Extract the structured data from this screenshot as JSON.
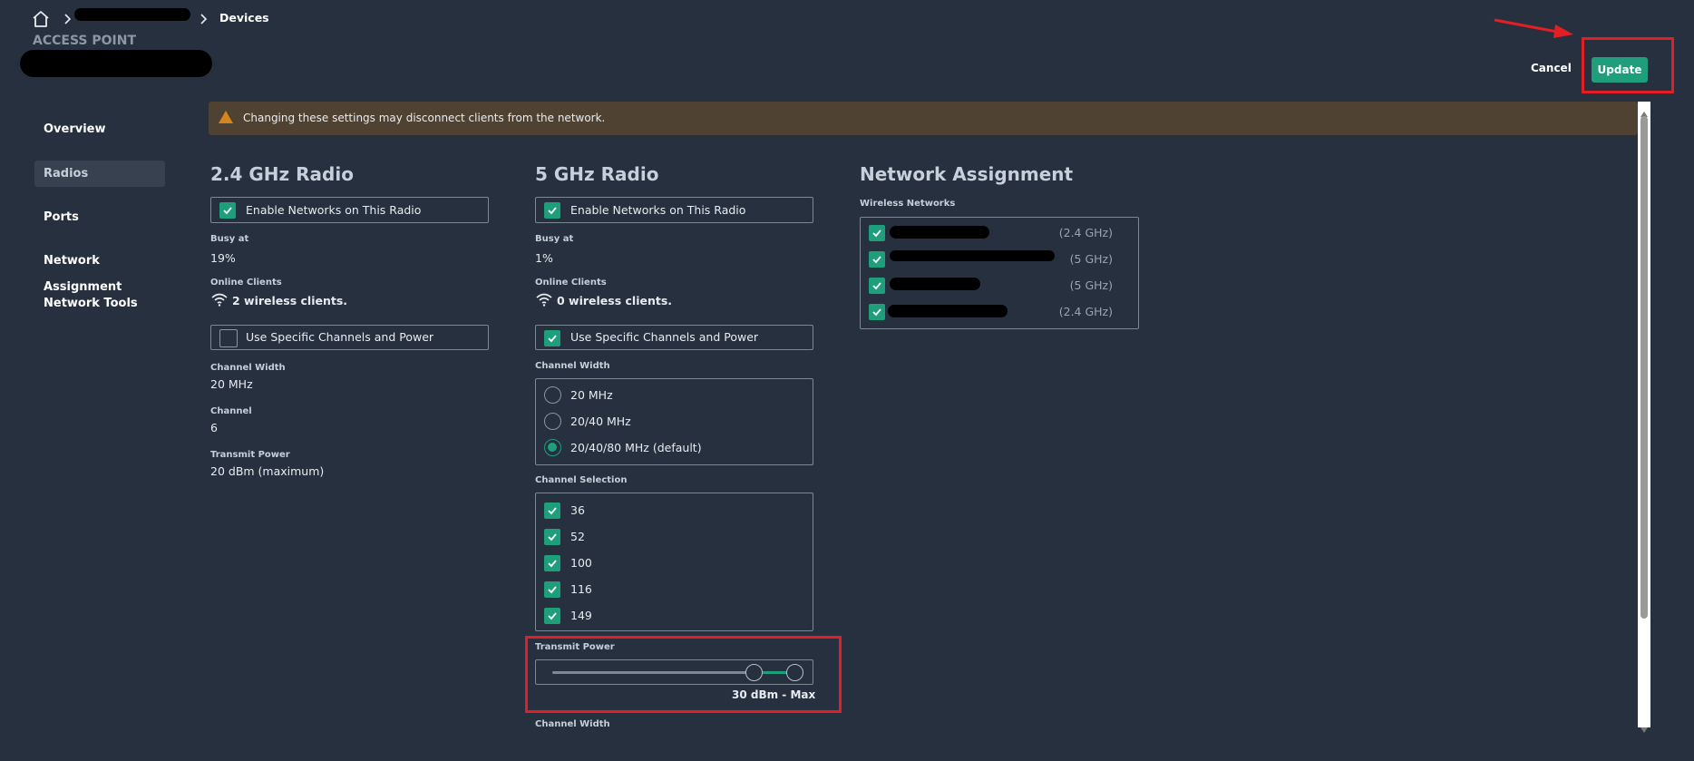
{
  "breadcrumb": {
    "current": "Devices"
  },
  "header": {
    "device_type": "ACCESS POINT",
    "cancel_label": "Cancel",
    "update_label": "Update"
  },
  "warning": {
    "text": "Changing these settings may disconnect clients from the network."
  },
  "sidebar": {
    "items": [
      {
        "label": "Overview"
      },
      {
        "label": "Radios"
      },
      {
        "label": "Ports"
      },
      {
        "label": "Network Assignment"
      },
      {
        "label": "Network Tools"
      }
    ]
  },
  "radio24": {
    "title": "2.4 GHz Radio",
    "enable_label": "Enable Networks on This Radio",
    "busy_label": "Busy at",
    "busy_value": "19%",
    "clients_label": "Online Clients",
    "clients_value": "2 wireless clients.",
    "specific_label": "Use Specific Channels and Power",
    "width_label": "Channel Width",
    "width_value": "20 MHz",
    "channel_label": "Channel",
    "channel_value": "6",
    "power_label": "Transmit Power",
    "power_value": "20 dBm (maximum)"
  },
  "radio5": {
    "title": "5 GHz Radio",
    "enable_label": "Enable Networks on This Radio",
    "busy_label": "Busy at",
    "busy_value": "1%",
    "clients_label": "Online Clients",
    "clients_value": "0 wireless clients.",
    "specific_label": "Use Specific Channels and Power",
    "width_label": "Channel Width",
    "width_options": [
      "20 MHz",
      "20/40 MHz",
      "20/40/80 MHz (default)"
    ],
    "width_selected": "20/40/80 MHz (default)",
    "selection_label": "Channel Selection",
    "channels": [
      "36",
      "52",
      "100",
      "116",
      "149"
    ],
    "power_label": "Transmit Power",
    "power_value": "30 dBm - Max",
    "power_fraction": 1.0,
    "width_label_2": "Channel Width"
  },
  "network_assignment": {
    "title": "Network Assignment",
    "wireless_label": "Wireless Networks",
    "networks": [
      {
        "band": "(2.4 GHz)"
      },
      {
        "band": "(5 GHz)"
      },
      {
        "band": "(5 GHz)"
      },
      {
        "band": "(2.4 GHz)"
      }
    ]
  },
  "colors": {
    "background": "#26303e",
    "accent": "#1f9e7c",
    "warning_bg": "#4f4232",
    "warning_icon": "#d4851f",
    "annotation": "#e31e24"
  }
}
